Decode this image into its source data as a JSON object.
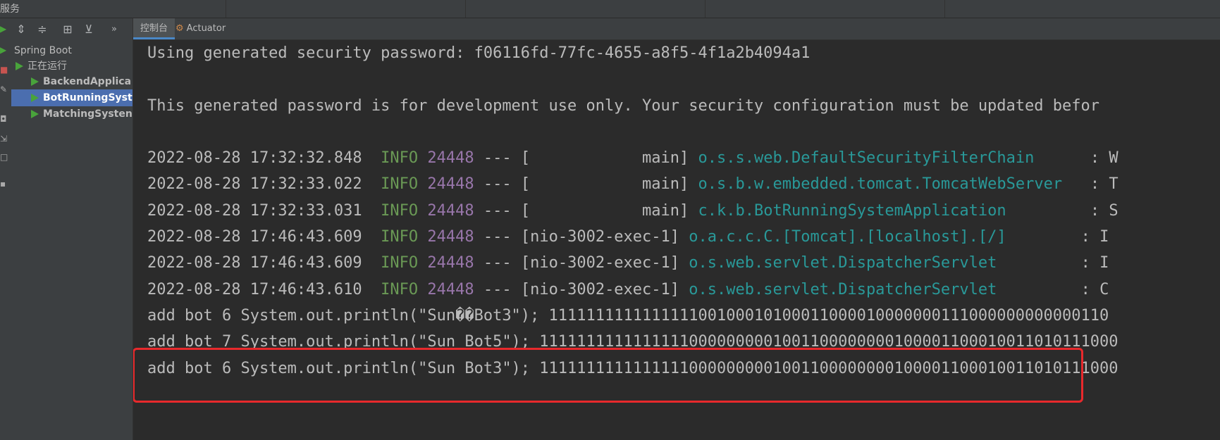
{
  "window": {
    "title": "服务"
  },
  "panel": {
    "toolbar_icons": [
      "expand-all-icon",
      "collapse-all-icon",
      "group-icon",
      "filter-icon",
      "more-icon"
    ],
    "tree": {
      "root": "Spring Boot",
      "group": "正在运行",
      "items": [
        "BackendApplica",
        "BotRunningSyst",
        "MatchingSysten"
      ]
    }
  },
  "tabs": [
    {
      "label": "控制台"
    },
    {
      "label": "Actuator"
    }
  ],
  "console": {
    "security_line": "Using generated security password: f06116fd-77fc-4655-a8f5-4f1a2b4094a1",
    "warning_line": "This generated password is for development use only. Your security configuration must be updated befor",
    "logs": [
      {
        "ts": "2022-08-28 17:32:32.848",
        "level": "INFO",
        "pid": "24448",
        "sep": "---",
        "thread": "[            main]",
        "logger": "o.s.s.web.DefaultSecurityFilterChain     ",
        "msg": ": W"
      },
      {
        "ts": "2022-08-28 17:32:33.022",
        "level": "INFO",
        "pid": "24448",
        "sep": "---",
        "thread": "[            main]",
        "logger": "o.s.b.w.embedded.tomcat.TomcatWebServer  ",
        "msg": ": T"
      },
      {
        "ts": "2022-08-28 17:32:33.031",
        "level": "INFO",
        "pid": "24448",
        "sep": "---",
        "thread": "[            main]",
        "logger": "c.k.b.BotRunningSystemApplication        ",
        "msg": ": S"
      },
      {
        "ts": "2022-08-28 17:46:43.609",
        "level": "INFO",
        "pid": "24448",
        "sep": "---",
        "thread": "[nio-3002-exec-1]",
        "logger": "o.a.c.c.C.[Tomcat].[localhost].[/]       ",
        "msg": ": I"
      },
      {
        "ts": "2022-08-28 17:46:43.609",
        "level": "INFO",
        "pid": "24448",
        "sep": "---",
        "thread": "[nio-3002-exec-1]",
        "logger": "o.s.web.servlet.DispatcherServlet        ",
        "msg": ": I"
      },
      {
        "ts": "2022-08-28 17:46:43.610",
        "level": "INFO",
        "pid": "24448",
        "sep": "---",
        "thread": "[nio-3002-exec-1]",
        "logger": "o.s.web.servlet.DispatcherServlet        ",
        "msg": ": C"
      }
    ],
    "bot_lines": [
      "add bot 6 System.out.println(\"Sun��Bot3\"); 111111111111111100100010100011000010000000111000000000000110",
      "add bot 7 System.out.println(\"Sun Bot5\"); 11111111111111110000000001001100000000100001100010011010111000",
      "add bot 6 System.out.println(\"Sun Bot3\"); 11111111111111110000000001001100000000100001100010011010111000"
    ]
  }
}
